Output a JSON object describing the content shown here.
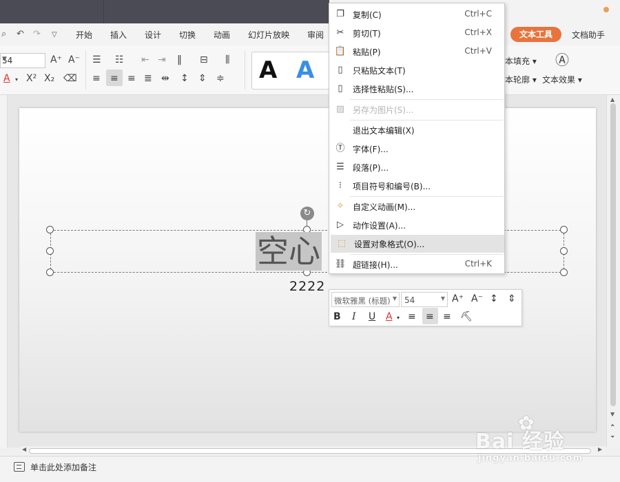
{
  "tabs": {
    "quick_icons": [
      "search-icon",
      "undo-icon",
      "redo-icon",
      "customize-icon"
    ],
    "items": [
      "开始",
      "插入",
      "设计",
      "切换",
      "动画",
      "幻灯片放映",
      "审阅"
    ],
    "active": "文本工具",
    "helper": "文档助手"
  },
  "ribbon": {
    "font_size": "54",
    "style_letters": [
      "A",
      "A"
    ],
    "text_fill": "本填充",
    "text_outline": "本轮廓",
    "text_effect": "文本效果",
    "colors": {
      "font_red": "#e03030",
      "style_blue": "#3a8ee6",
      "accent_orange": "#e8733c"
    }
  },
  "slide": {
    "selected_text": "空心",
    "subtitle": "2222"
  },
  "mini_toolbar": {
    "font_name": "微软雅黑 (标题)",
    "font_size": "54"
  },
  "context_menu": {
    "items": [
      {
        "icon": "copy-icon",
        "label": "复制(C)",
        "shortcut": "Ctrl+C",
        "disabled": false,
        "highlighted": false
      },
      {
        "icon": "cut-icon",
        "label": "剪切(T)",
        "shortcut": "Ctrl+X",
        "disabled": false,
        "highlighted": false
      },
      {
        "icon": "paste-icon",
        "label": "粘贴(P)",
        "shortcut": "Ctrl+V",
        "disabled": false,
        "highlighted": false
      },
      {
        "icon": "paste-text-icon",
        "label": "只粘贴文本(T)",
        "shortcut": "",
        "disabled": false,
        "highlighted": false
      },
      {
        "icon": "paste-special-icon",
        "label": "选择性粘贴(S)...",
        "shortcut": "",
        "disabled": false,
        "highlighted": false
      },
      {
        "icon": "save-image-icon",
        "label": "另存为图片(S)...",
        "shortcut": "",
        "disabled": true,
        "highlighted": false
      },
      {
        "icon": "",
        "label": "退出文本编辑(X)",
        "shortcut": "",
        "disabled": false,
        "highlighted": false
      },
      {
        "icon": "font-icon",
        "label": "字体(F)...",
        "shortcut": "",
        "disabled": false,
        "highlighted": false
      },
      {
        "icon": "paragraph-icon",
        "label": "段落(P)...",
        "shortcut": "",
        "disabled": false,
        "highlighted": false
      },
      {
        "icon": "bullets-icon",
        "label": "项目符号和编号(B)...",
        "shortcut": "",
        "disabled": false,
        "highlighted": false
      },
      {
        "icon": "custom-animation-icon",
        "label": "自定义动画(M)...",
        "shortcut": "",
        "disabled": false,
        "highlighted": false
      },
      {
        "icon": "action-icon",
        "label": "动作设置(A)...",
        "shortcut": "",
        "disabled": false,
        "highlighted": false
      },
      {
        "icon": "format-object-icon",
        "label": "设置对象格式(O)...",
        "shortcut": "",
        "disabled": false,
        "highlighted": true
      },
      {
        "icon": "hyperlink-icon",
        "label": "超链接(H)...",
        "shortcut": "Ctrl+K",
        "disabled": false,
        "highlighted": false
      }
    ]
  },
  "notes": {
    "placeholder": "单击此处添加备注"
  },
  "watermark": {
    "logo": "Bai 经验",
    "url": "jingyan.baidu.com"
  }
}
